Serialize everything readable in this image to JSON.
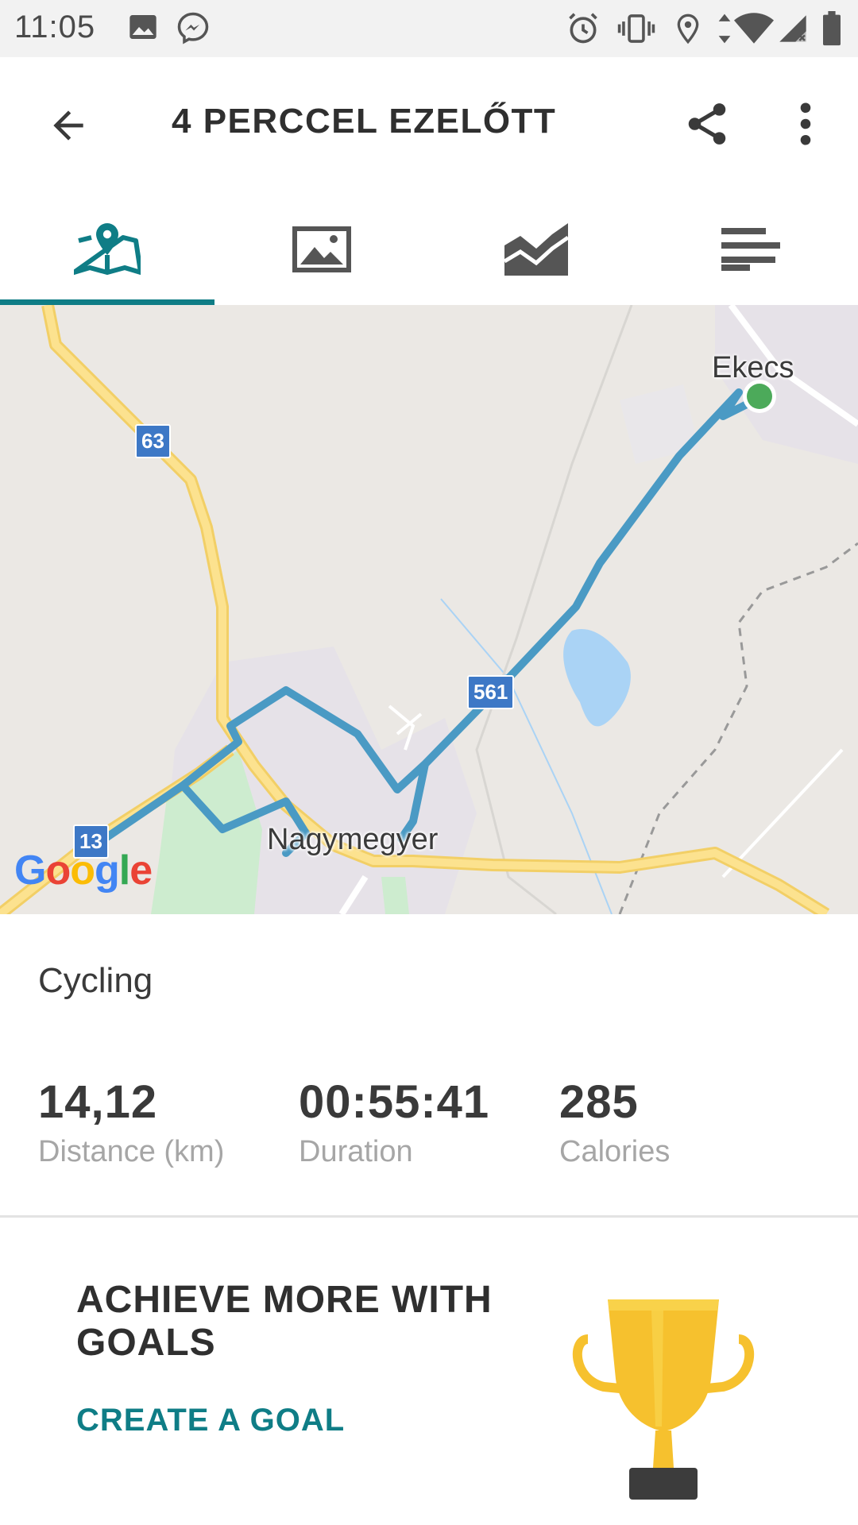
{
  "status_bar": {
    "time": "11:05",
    "icons": [
      "image-icon",
      "messenger-icon",
      "alarm-icon",
      "vibrate-icon",
      "location-icon",
      "data-arrows-icon",
      "wifi-icon",
      "cell-signal-icon",
      "battery-icon"
    ]
  },
  "app_bar": {
    "title": "4 PERCCEL EZELŐTT",
    "back_icon": "arrow-back-icon",
    "share_icon": "share-icon",
    "more_icon": "more-vert-icon"
  },
  "tabs": [
    {
      "icon": "map-pin-icon",
      "active": true
    },
    {
      "icon": "photo-icon",
      "active": false
    },
    {
      "icon": "chart-icon",
      "active": false
    },
    {
      "icon": "list-icon",
      "active": false
    }
  ],
  "map": {
    "labels": {
      "ekecs": "Ekecs",
      "nagymegyer": "Nagymegyer"
    },
    "road_badges": {
      "r63": "63",
      "r561": "561",
      "r13": "13"
    },
    "logo": {
      "G": "G",
      "o1": "o",
      "o2": "o",
      "g": "g",
      "l": "l",
      "e": "e"
    }
  },
  "activity": {
    "type": "Cycling",
    "stats": {
      "distance": {
        "value": "14,12",
        "label": "Distance (km)"
      },
      "duration": {
        "value": "00:55:41",
        "label": "Duration"
      },
      "calories": {
        "value": "285",
        "label": "Calories"
      }
    }
  },
  "goals_card": {
    "title": "ACHIEVE MORE WITH GOALS",
    "link": "CREATE A GOAL",
    "icon": "trophy-icon"
  },
  "colors": {
    "accent": "#0f7d86",
    "route": "#4a9ac4",
    "road_major": "#f7d774",
    "map_bg": "#ebe8e4",
    "trophy": "#f6c12e"
  }
}
